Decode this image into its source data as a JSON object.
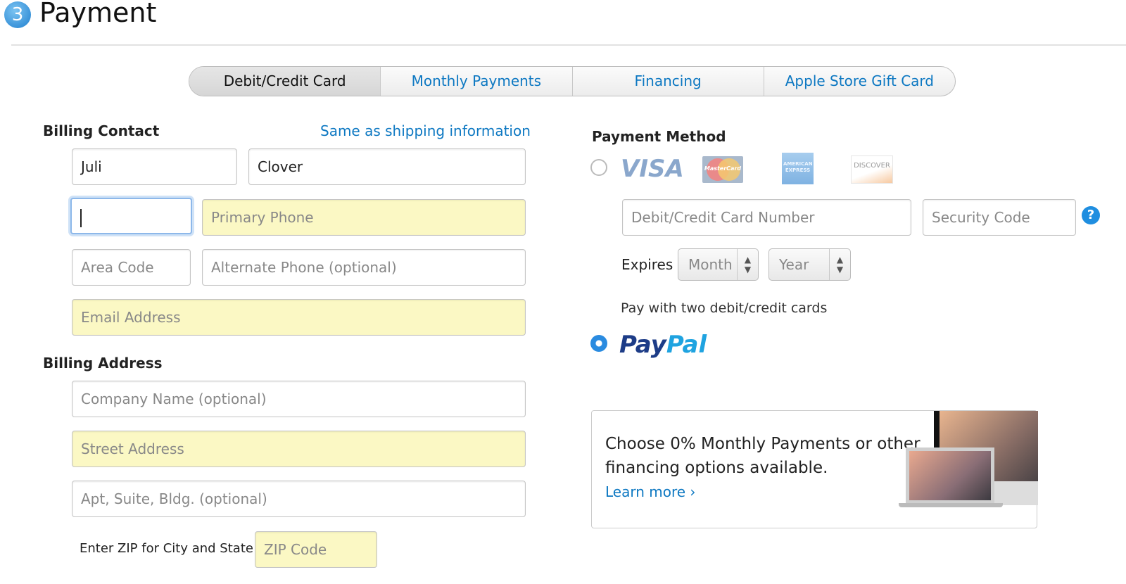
{
  "header": {
    "step": "3",
    "title": "Payment"
  },
  "tabs": [
    "Debit/Credit Card",
    "Monthly Payments",
    "Financing",
    "Apple Store Gift Card"
  ],
  "billing_contact": {
    "heading": "Billing Contact",
    "same_link": "Same as shipping information",
    "first_name": "Juli",
    "last_name": "Clover",
    "area_code_focused": "",
    "primary_phone": "Primary Phone",
    "area_code": "Area Code",
    "alt_phone": "Alternate Phone (optional)",
    "email": "Email Address"
  },
  "billing_address": {
    "heading": "Billing Address",
    "company": "Company Name (optional)",
    "street": "Street Address",
    "apt": "Apt, Suite, Bldg. (optional)",
    "zip_label": "Enter ZIP for City and State",
    "zip": "ZIP Code"
  },
  "payment": {
    "heading": "Payment Method",
    "cards": [
      "VISA",
      "MasterCard",
      "American Express",
      "DISCOVER"
    ],
    "card_number": "Debit/Credit Card Number",
    "security_code": "Security Code",
    "help": "?",
    "expires_label": "Expires",
    "month": "Month",
    "year": "Year",
    "two_cards": "Pay with two debit/credit cards",
    "paypal_pay": "Pay",
    "paypal_pal": "Pal",
    "selected": "paypal"
  },
  "promo": {
    "line1": "Choose 0% Monthly Payments or other",
    "line2": "financing options available.",
    "link": "Learn more ›"
  },
  "colors": {
    "link": "#0d78c2",
    "required_field": "#fbf8c4",
    "paypal_dark": "#1d3c87",
    "paypal_light": "#1fa3e0"
  }
}
